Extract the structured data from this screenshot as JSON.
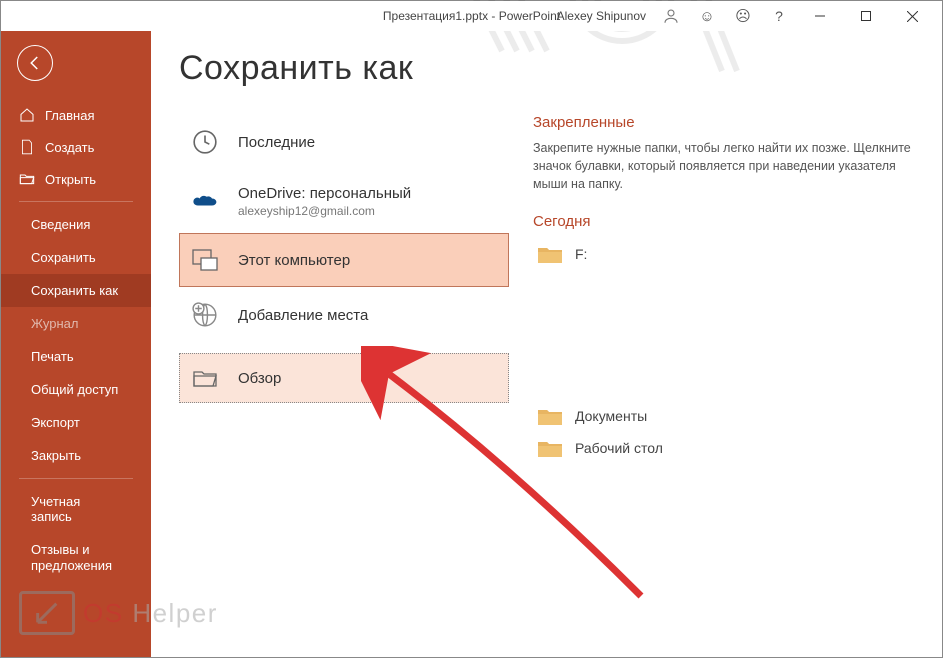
{
  "title": "Презентация1.pptx  -  PowerPoint",
  "user": "Alexey Shipunov",
  "page_heading": "Сохранить как",
  "sidebar": {
    "home": "Главная",
    "new": "Создать",
    "open": "Открыть",
    "info": "Сведения",
    "save": "Сохранить",
    "saveas": "Сохранить как",
    "history": "Журнал",
    "print": "Печать",
    "share": "Общий доступ",
    "export": "Экспорт",
    "close": "Закрыть",
    "account": "Учетная запись",
    "feedback": "Отзывы и предложения"
  },
  "locations": {
    "recent": "Последние",
    "onedrive": "OneDrive: персональный",
    "onedrive_sub": "alexeyship12@gmail.com",
    "thispc": "Этот компьютер",
    "addplace": "Добавление места",
    "browse": "Обзор"
  },
  "right": {
    "pinned_h": "Закрепленные",
    "pinned_desc": "Закрепите нужные папки, чтобы легко найти их позже. Щелкните значок булавки, который появляется при наведении указателя мыши на папку.",
    "today_h": "Сегодня",
    "folders": {
      "f": "F:",
      "docs": "Документы",
      "desktop": "Рабочий стол"
    }
  },
  "watermark": "OS Helper"
}
